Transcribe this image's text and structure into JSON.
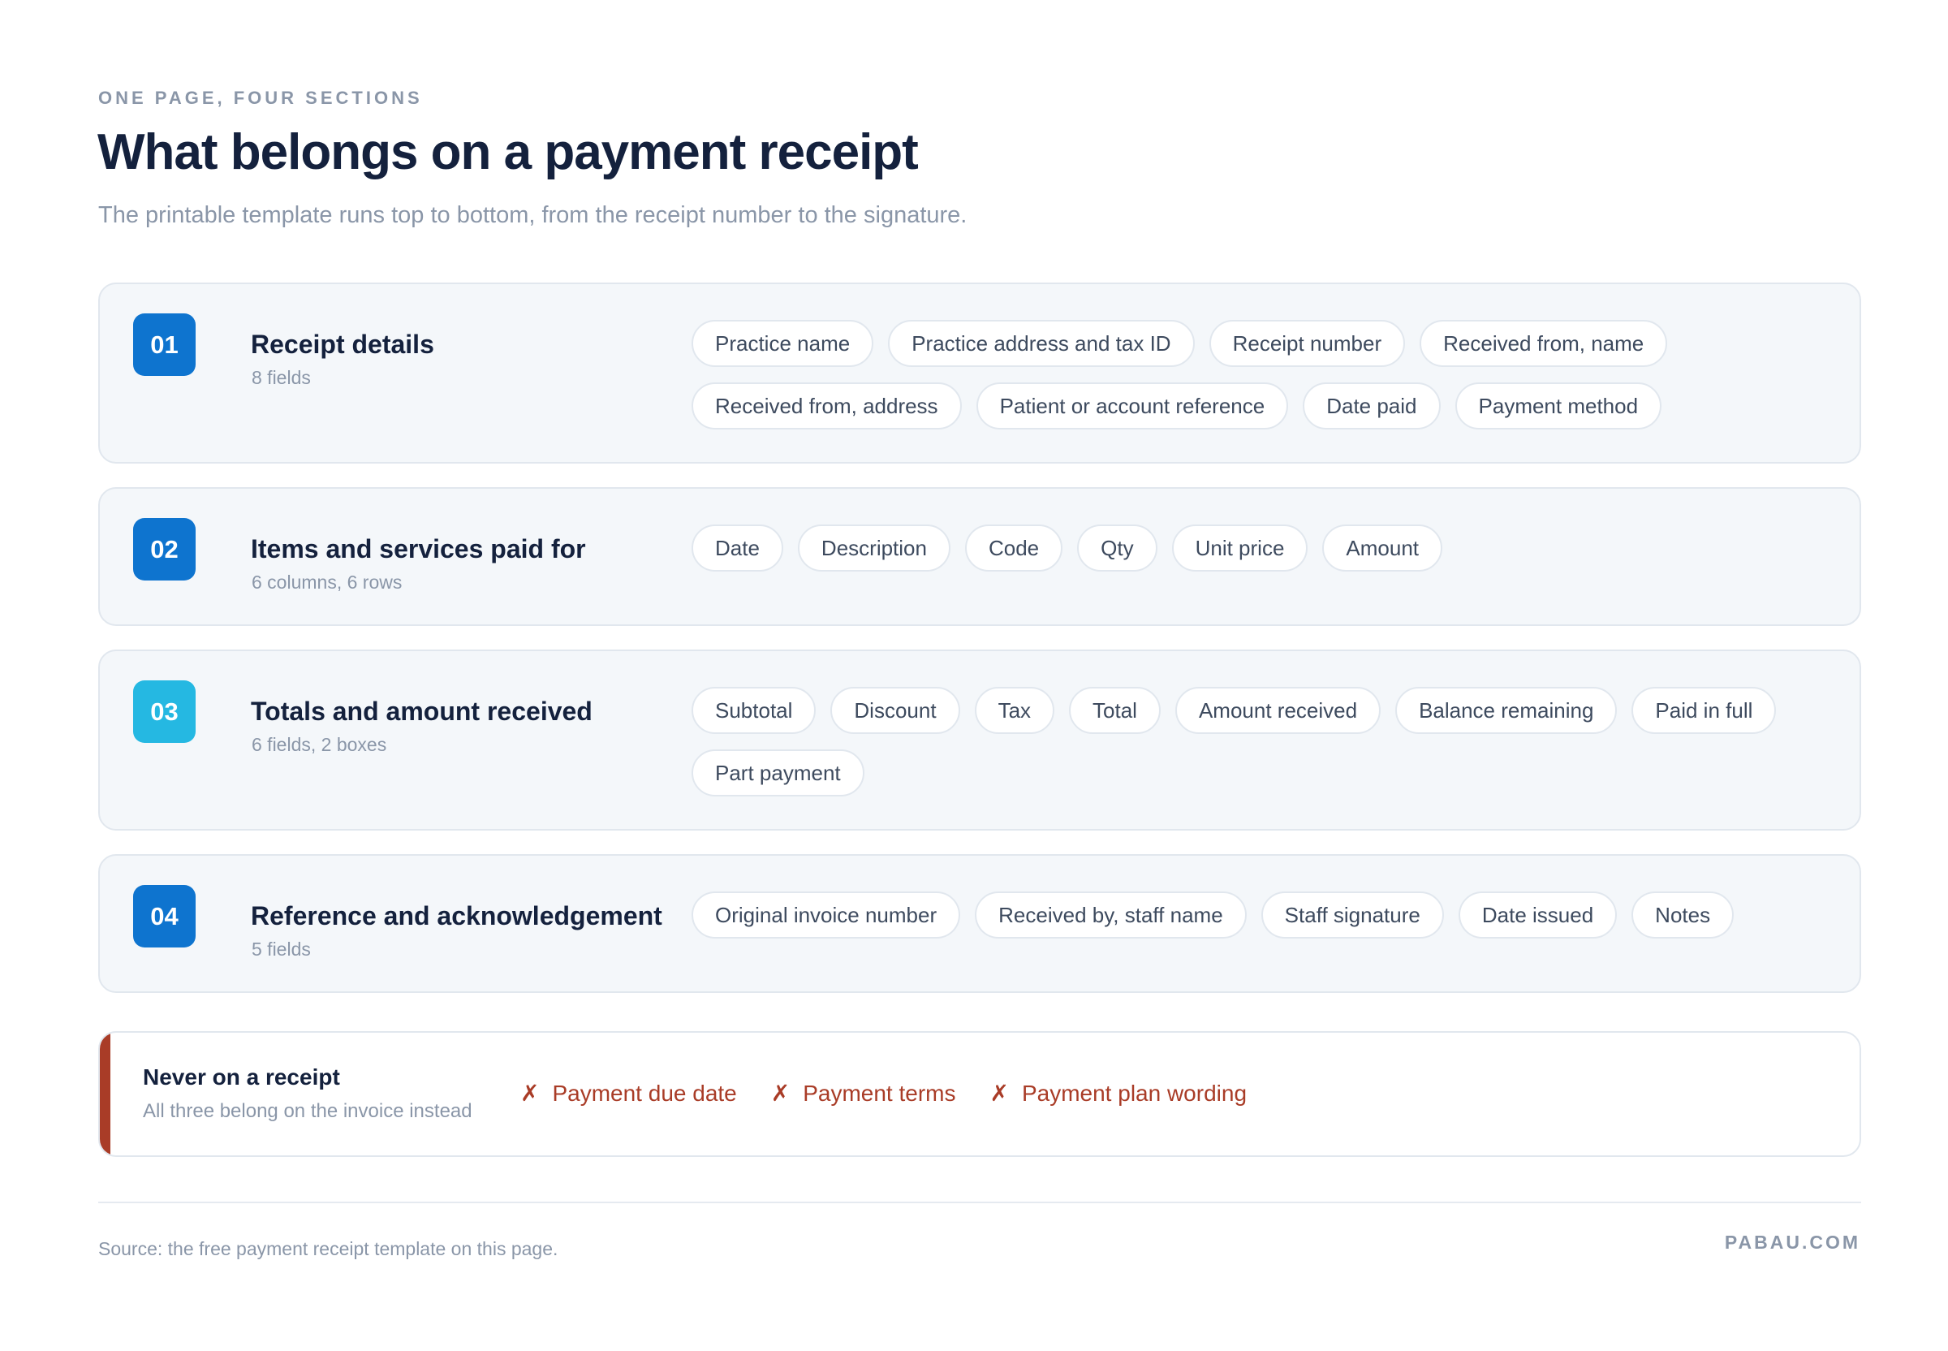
{
  "eyebrow": "ONE PAGE, FOUR SECTIONS",
  "title": "What belongs on a payment receipt",
  "subtitle": "The printable template runs top to bottom, from the receipt number to the signature.",
  "sections": [
    {
      "number": "01",
      "title": "Receipt details",
      "meta": "8 fields",
      "fields": [
        "Practice name",
        "Practice address and tax ID",
        "Receipt number",
        "Received from, name",
        "Received from, address",
        "Patient or account reference",
        "Date paid",
        "Payment method"
      ]
    },
    {
      "number": "02",
      "title": "Items and services paid for",
      "meta": "6 columns, 6 rows",
      "fields": [
        "Date",
        "Description",
        "Code",
        "Qty",
        "Unit price",
        "Amount"
      ]
    },
    {
      "number": "03",
      "title": "Totals and amount received",
      "meta": "6 fields, 2 boxes",
      "fields": [
        "Subtotal",
        "Discount",
        "Tax",
        "Total",
        "Amount received",
        "Balance remaining",
        "Paid in full",
        "Part payment"
      ]
    },
    {
      "number": "04",
      "title": "Reference and acknowledgement",
      "meta": "5 fields",
      "fields": [
        "Original invoice number",
        "Received by, staff name",
        "Staff signature",
        "Date issued",
        "Notes"
      ]
    }
  ],
  "never": {
    "title": "Never on a receipt",
    "subtitle": "All three belong on the invoice instead",
    "mark": "✗",
    "items": [
      "Payment due date",
      "Payment terms",
      "Payment plan wording"
    ]
  },
  "footer": {
    "source": "Source: the free payment receipt template on this page.",
    "brand": "PABAU.COM"
  },
  "colors": {
    "badge_blue": "#0e74cf",
    "badge_cyan": "#25b8e2",
    "warning_red": "#a93c27"
  }
}
